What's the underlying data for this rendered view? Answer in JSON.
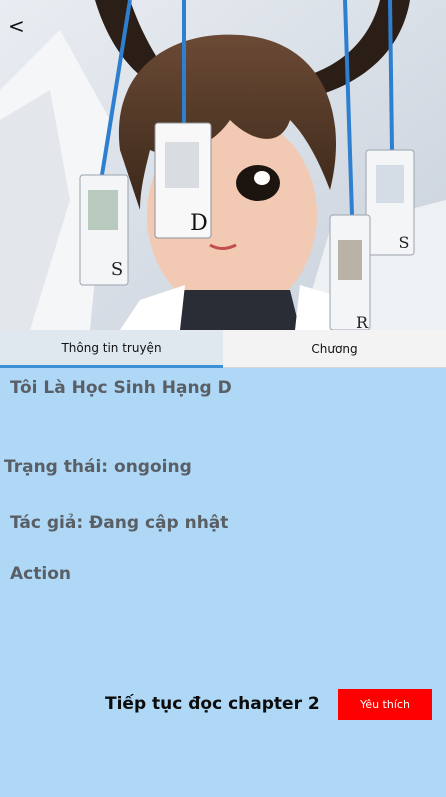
{
  "header": {
    "back_icon": "chevron-left-icon",
    "back_glyph": "<"
  },
  "cover": {
    "card_letters": [
      "D",
      "S",
      "S",
      "R"
    ]
  },
  "tabs": [
    {
      "label": "Thông tin truyện",
      "active": true
    },
    {
      "label": "Chương",
      "active": false
    }
  ],
  "info": {
    "title": "Tôi Là Học Sinh Hạng D",
    "status": "Trạng thái: ongoing",
    "author": "Tác giả: Đang cập nhật",
    "genre": "Action"
  },
  "actions": {
    "continue_label": "Tiếp tục đọc chapter 2",
    "favorite_label": "Yêu thích"
  },
  "colors": {
    "background": "#aed8f6",
    "tab_indicator": "#3d8fd6",
    "favorite_button": "#ff0000"
  }
}
